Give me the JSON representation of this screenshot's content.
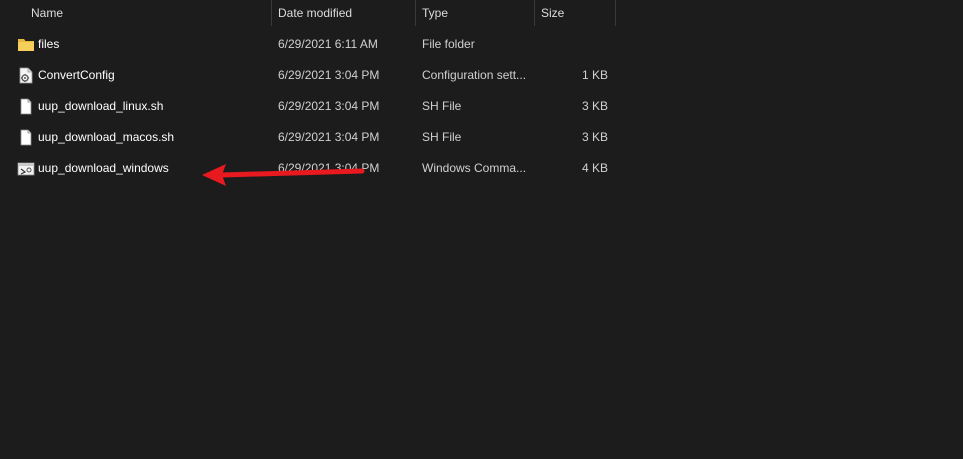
{
  "columns": {
    "name": "Name",
    "date_modified": "Date modified",
    "type": "Type",
    "size": "Size"
  },
  "files": [
    {
      "name": "files",
      "date": "6/29/2021 6:11 AM",
      "type": "File folder",
      "size": "",
      "icon": "folder-icon"
    },
    {
      "name": "ConvertConfig",
      "date": "6/29/2021 3:04 PM",
      "type": "Configuration sett...",
      "size": "1 KB",
      "icon": "config-file-icon"
    },
    {
      "name": "uup_download_linux.sh",
      "date": "6/29/2021 3:04 PM",
      "type": "SH File",
      "size": "3 KB",
      "icon": "document-icon"
    },
    {
      "name": "uup_download_macos.sh",
      "date": "6/29/2021 3:04 PM",
      "type": "SH File",
      "size": "3 KB",
      "icon": "document-icon"
    },
    {
      "name": "uup_download_windows",
      "date": "6/29/2021 3:04 PM",
      "type": "Windows Comma...",
      "size": "4 KB",
      "icon": "cmd-file-icon"
    }
  ],
  "colors": {
    "background": "#1c1c1c",
    "annotation_arrow": "#e8191f",
    "folder": "#f2c94c"
  }
}
